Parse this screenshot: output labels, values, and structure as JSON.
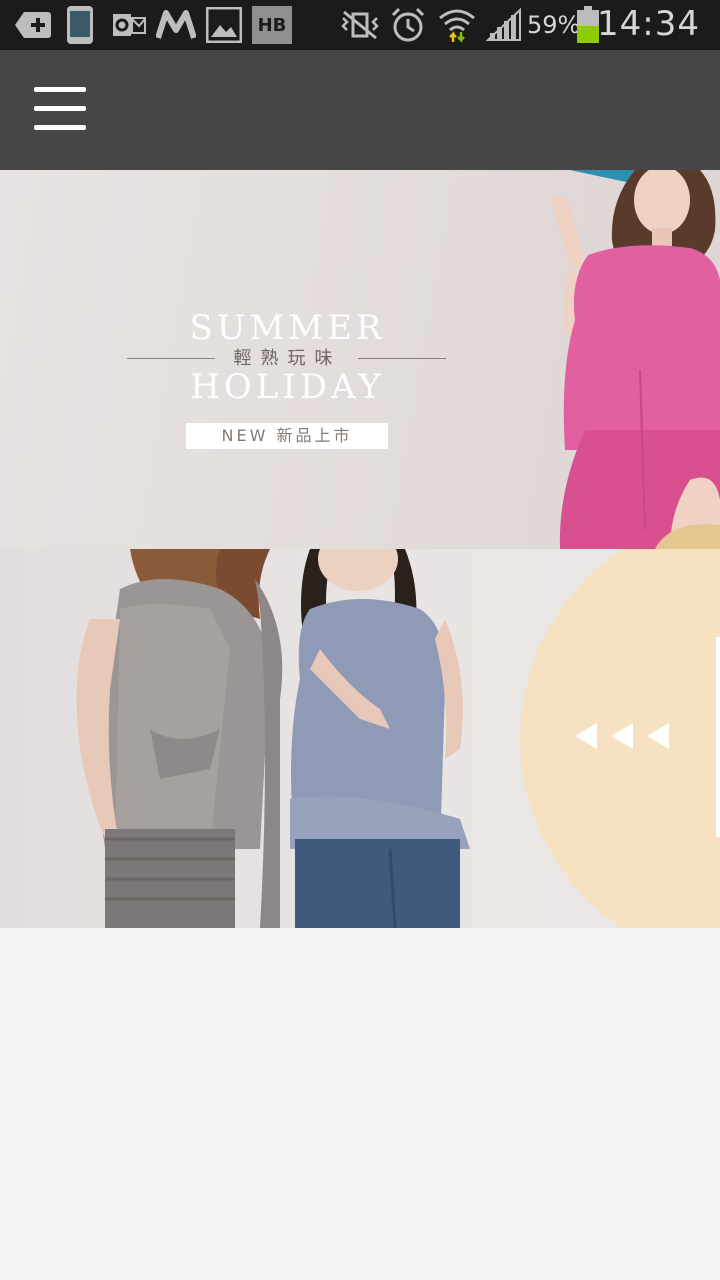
{
  "status_bar": {
    "battery_percent": "59%",
    "time": "14:34",
    "icons": [
      "add-icon",
      "phone-icon",
      "outlook-icon",
      "m-app-icon",
      "gallery-icon",
      "hb-app-icon",
      "vibrate-off-icon",
      "alarm-icon",
      "wifi-icon",
      "signal-icon",
      "battery-icon"
    ],
    "hb_label": "HB"
  },
  "app_bar": {
    "menu_icon": "hamburger-menu-icon"
  },
  "banner1": {
    "headline_top": "SUMMER",
    "headline_cn": "輕熟玩味",
    "headline_bottom": "HOLIDAY",
    "tag": "NEW 新品上市",
    "bg_color": "#e4dedd",
    "accent_color": "#e0589a"
  },
  "banner2": {
    "disc_color": "#f6e2c1",
    "arrows": [
      "arrow-left-icon",
      "arrow-left-icon",
      "arrow-left-icon"
    ]
  }
}
